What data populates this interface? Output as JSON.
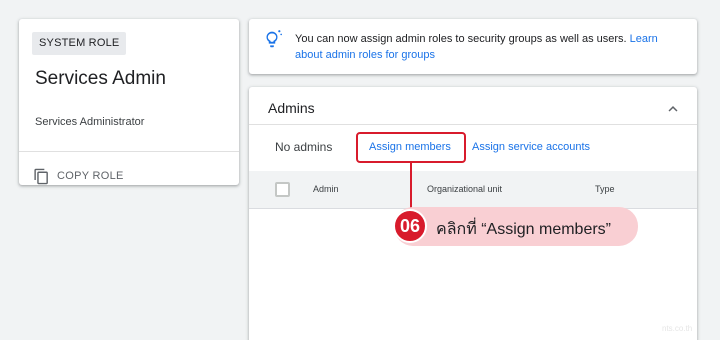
{
  "role_card": {
    "chip_label": "SYSTEM ROLE",
    "role_name": "Services Admin",
    "role_description": "Services Administrator",
    "copy_role_label": "COPY ROLE"
  },
  "info_banner": {
    "text": "You can now assign admin roles to security groups as well as users. ",
    "link_text": "Learn about admin roles for groups"
  },
  "admins_panel": {
    "title": "Admins",
    "no_admins_label": "No admins",
    "assign_members_label": "Assign members",
    "assign_service_accounts_label": "Assign service accounts",
    "columns": [
      "Admin",
      "Organizational unit",
      "Type"
    ]
  },
  "callout": {
    "step_number": "06",
    "instruction": "คลิกที่ “Assign members”"
  },
  "watermark": "nts.co.th",
  "colors": {
    "accent": "#1a73e8",
    "callout_red": "#d81b2c",
    "callout_pink": "#f9cfd3"
  }
}
